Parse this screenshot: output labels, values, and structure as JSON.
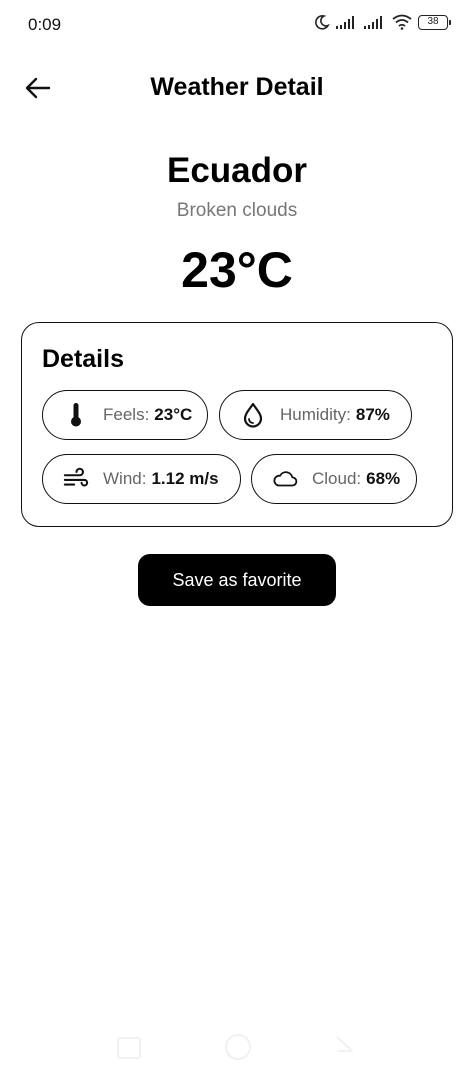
{
  "status_bar": {
    "time": "0:09",
    "battery": "38"
  },
  "header": {
    "title": "Weather Detail"
  },
  "hero": {
    "city": "Ecuador",
    "condition": "Broken clouds",
    "temperature": "23°C"
  },
  "details": {
    "title": "Details",
    "items": [
      {
        "icon": "thermometer-icon",
        "label": "Feels:",
        "value": "23°C"
      },
      {
        "icon": "water-drop-icon",
        "label": "Humidity:",
        "value": "87%"
      },
      {
        "icon": "wind-icon",
        "label": "Wind:",
        "value": "1.12 m/s"
      },
      {
        "icon": "cloud-icon",
        "label": "Cloud:",
        "value": "68%"
      }
    ]
  },
  "actions": {
    "save_label": "Save as favorite"
  },
  "colors": {
    "primary": "#000000",
    "secondary_text": "#777777",
    "background": "#ffffff"
  }
}
